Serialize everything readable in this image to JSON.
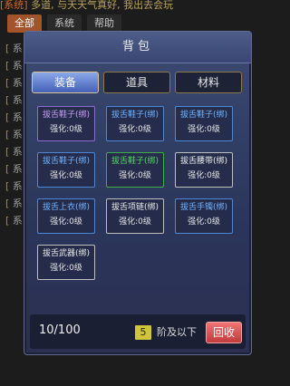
{
  "ticker": {
    "tag": "[系统]",
    "text": "多道, 与天天气真好, 我出去会玩"
  },
  "top_tabs": [
    {
      "label": "全部",
      "active": true
    },
    {
      "label": "系统",
      "active": false
    },
    {
      "label": "帮助",
      "active": false
    }
  ],
  "chat": {
    "lines": [
      "系",
      "系",
      "系",
      "系",
      "系",
      "系",
      "系",
      "系",
      "系",
      "系",
      "系"
    ]
  },
  "bag": {
    "title": "背包",
    "tabs": [
      {
        "label": "装备",
        "active": true
      },
      {
        "label": "道具",
        "active": false
      },
      {
        "label": "材料",
        "active": false
      }
    ],
    "items": [
      {
        "name": "拔舌鞋子(绑)",
        "level": "强化:0级",
        "quality": "purple"
      },
      {
        "name": "拔舌鞋子(绑)",
        "level": "强化:0级",
        "quality": "blue"
      },
      {
        "name": "拔舌鞋子(绑)",
        "level": "强化:0级",
        "quality": "blue"
      },
      {
        "name": "拔舌鞋子(绑)",
        "level": "强化:0级",
        "quality": "blue"
      },
      {
        "name": "拔舌鞋子(绑)",
        "level": "强化:0级",
        "quality": "green"
      },
      {
        "name": "拔舌腰带(绑)",
        "level": "强化:0级",
        "quality": "white"
      },
      {
        "name": "拔舌上衣(绑)",
        "level": "强化:0级",
        "quality": "blue"
      },
      {
        "name": "拔舌项链(绑)",
        "level": "强化:0级",
        "quality": "white"
      },
      {
        "name": "拔舌手镯(绑)",
        "level": "强化:0级",
        "quality": "blue"
      },
      {
        "name": "拔舌武器(绑)",
        "level": "强化:0级",
        "quality": "white"
      }
    ],
    "footer": {
      "count": "10/100",
      "filter_level": "5",
      "filter_text": "阶及以下",
      "recycle_label": "回收"
    }
  }
}
